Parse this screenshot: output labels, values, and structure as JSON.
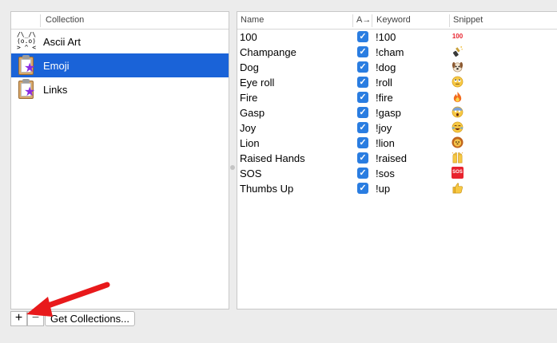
{
  "collections_panel": {
    "column_header": "Collection",
    "items": [
      {
        "label": "Ascii Art",
        "icon": "ascii-cat-icon",
        "icon_art": "/\\_/\\\n(o.o)\n> ^ <"
      },
      {
        "label": "Emoji",
        "icon": "clipboard-star-icon",
        "selected": true
      },
      {
        "label": "Links",
        "icon": "clipboard-star-icon"
      }
    ]
  },
  "snippets_table": {
    "headers": {
      "name": "Name",
      "auto_expand": "A→",
      "keyword": "Keyword",
      "snippet": "Snippet"
    },
    "rows": [
      {
        "name": "100",
        "checked": "✓",
        "keyword": "!100",
        "snippet_icon": "hundred-points-icon",
        "snippet_text": "100"
      },
      {
        "name": "Champange",
        "checked": "✓",
        "keyword": "!cham",
        "snippet_icon": "champagne-bottle-icon"
      },
      {
        "name": "Dog",
        "checked": "✓",
        "keyword": "!dog",
        "snippet_icon": "dog-face-icon"
      },
      {
        "name": "Eye roll",
        "checked": "✓",
        "keyword": "!roll",
        "snippet_icon": "eye-roll-face-icon"
      },
      {
        "name": "Fire",
        "checked": "✓",
        "keyword": "!fire",
        "snippet_icon": "fire-icon"
      },
      {
        "name": "Gasp",
        "checked": "✓",
        "keyword": "!gasp",
        "snippet_icon": "screaming-face-icon"
      },
      {
        "name": "Joy",
        "checked": "✓",
        "keyword": "!joy",
        "snippet_icon": "tears-of-joy-face-icon"
      },
      {
        "name": "Lion",
        "checked": "✓",
        "keyword": "!lion",
        "snippet_icon": "lion-face-icon"
      },
      {
        "name": "Raised Hands",
        "checked": "✓",
        "keyword": "!raised",
        "snippet_icon": "raised-hands-icon"
      },
      {
        "name": "SOS",
        "checked": "✓",
        "keyword": "!sos",
        "snippet_icon": "sos-button-icon",
        "snippet_text": "SOS"
      },
      {
        "name": "Thumbs Up",
        "checked": "✓",
        "keyword": "!up",
        "snippet_icon": "thumbs-up-icon"
      }
    ]
  },
  "bottom_bar": {
    "add_label": "+",
    "remove_label": "−",
    "get_collections_label": "Get Collections..."
  },
  "colors": {
    "selection": "#1a63d8",
    "checkbox": "#2a7de1",
    "annotation_arrow": "#e8191b"
  }
}
